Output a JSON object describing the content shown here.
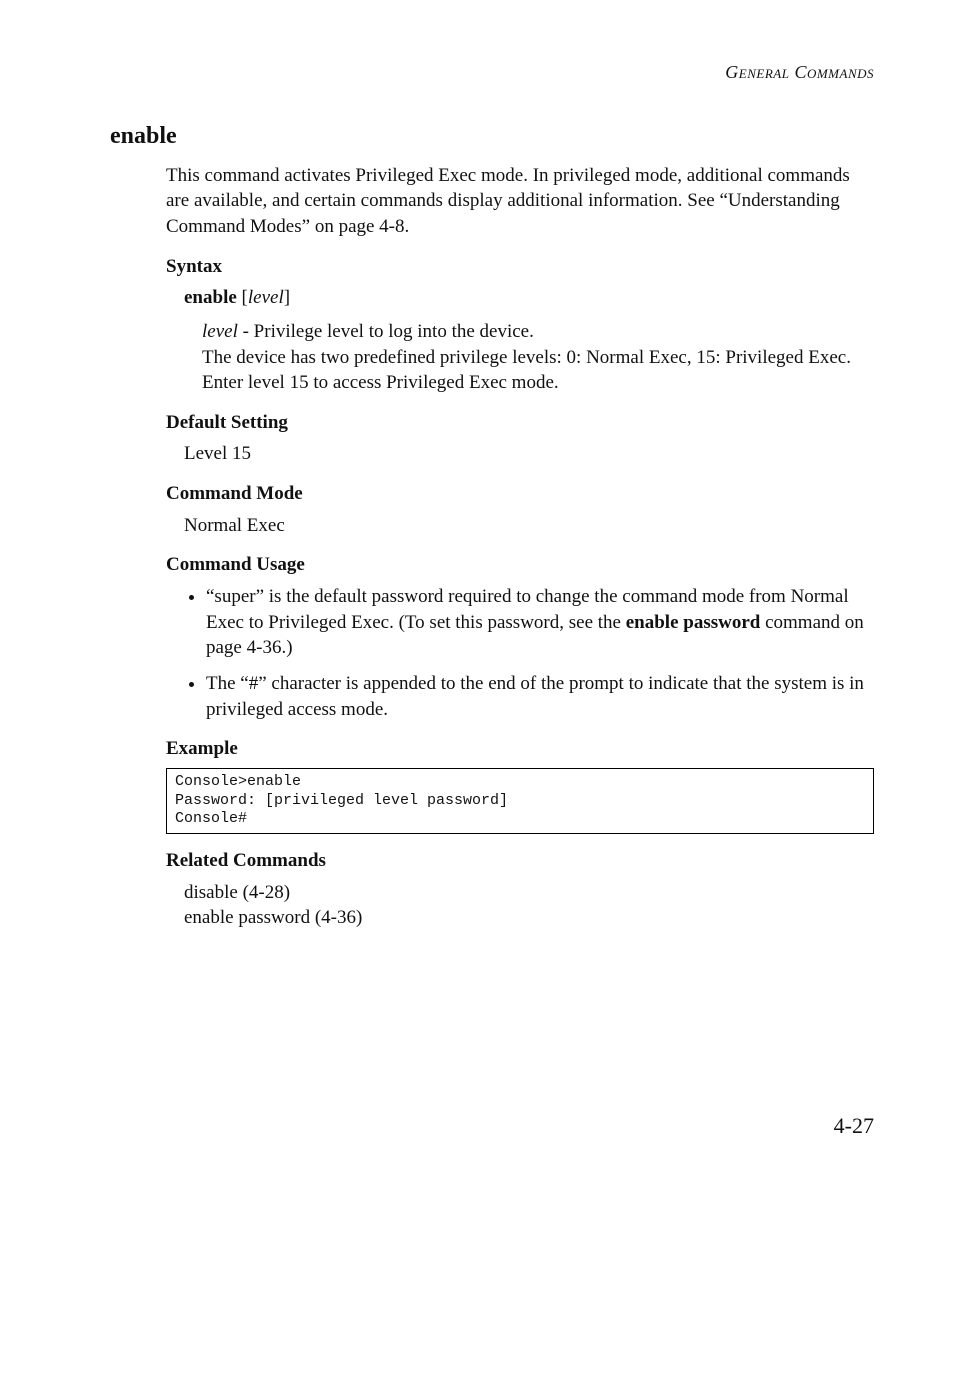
{
  "runningHead": "General Commands",
  "title": "enable",
  "intro": "This command activates Privileged Exec mode. In privileged mode, additional commands are available, and certain commands display additional information. See “Understanding Command Modes” on page 4-8.",
  "syntax": {
    "heading": "Syntax",
    "command": "enable",
    "arg_bracket_open": " [",
    "arg": "level",
    "arg_bracket_close": "]",
    "arg_name": "level",
    "arg_dash": " - Privilege level to log into the device.",
    "arg_desc2": "The device has two predefined privilege levels: 0: Normal Exec, 15: Privileged Exec. Enter level 15 to access Privileged Exec mode."
  },
  "defaultSetting": {
    "heading": "Default Setting",
    "value": "Level 15"
  },
  "commandMode": {
    "heading": "Command Mode",
    "value": "Normal Exec"
  },
  "usage": {
    "heading": "Command Usage",
    "bullet1_a": "“super” is the default password required to change the command mode from Normal Exec to Privileged Exec. (To set this password, see the ",
    "bullet1_bold": "enable password",
    "bullet1_b": " command on page 4-36.)",
    "bullet2": "The “#” character is appended to the end of the prompt to indicate that the system is in privileged access mode."
  },
  "example": {
    "heading": "Example",
    "console": "Console>enable\nPassword: [privileged level password]\nConsole#"
  },
  "related": {
    "heading": "Related Commands",
    "line1": "disable (4-28)",
    "line2": "enable password (4-36)"
  },
  "pageNumber": "4-27"
}
